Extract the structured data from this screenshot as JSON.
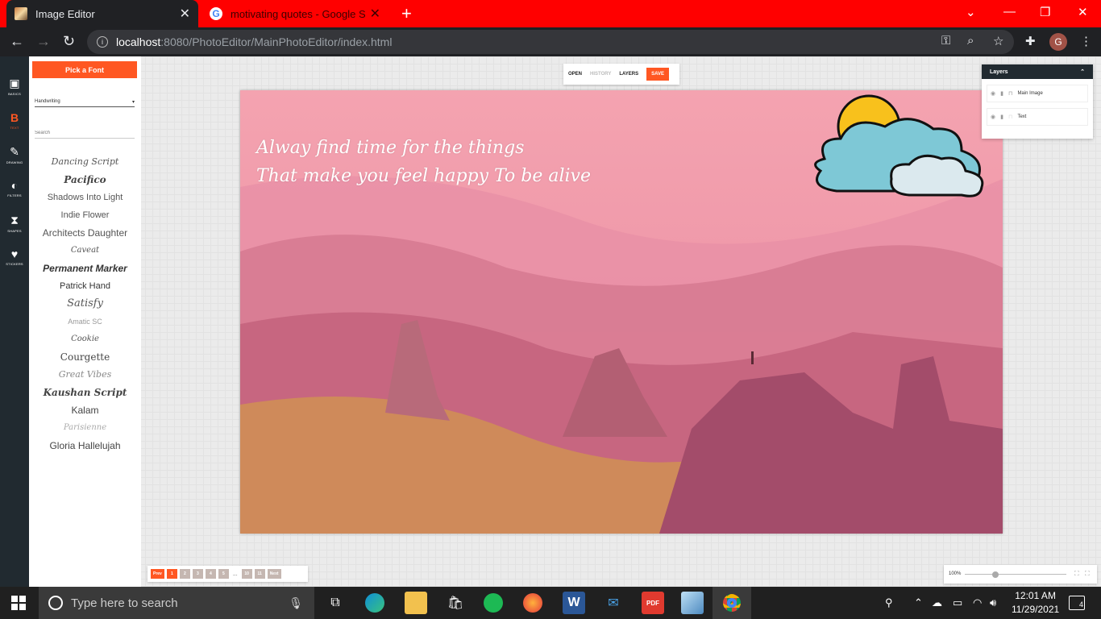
{
  "browser": {
    "tabs": [
      {
        "title": "Image Editor"
      },
      {
        "title": "motivating quotes - Google Sear",
        "favicon": "G"
      }
    ],
    "address": {
      "host": "localhost",
      "path": ":8080/PhotoEditor/MainPhotoEditor/index.html"
    },
    "avatar_letter": "G"
  },
  "rail": {
    "items": [
      {
        "label": "BASICS",
        "icon": "image-icon"
      },
      {
        "label": "TEXT",
        "icon": "text-icon",
        "glyph": "B"
      },
      {
        "label": "DRAWING",
        "icon": "brush-icon"
      },
      {
        "label": "FILTERS",
        "icon": "filters-icon"
      },
      {
        "label": "SHAPES",
        "icon": "shapes-icon"
      },
      {
        "label": "STICKERS",
        "icon": "heart-icon"
      }
    ]
  },
  "font_panel": {
    "pick_label": "Pick a Font",
    "category": "Handwriting",
    "search_placeholder": "Search",
    "fonts": [
      "Dancing Script",
      "Pacifico",
      "Shadows Into Light",
      "Indie Flower",
      "Architects Daughter",
      "Caveat",
      "Permanent Marker",
      "Patrick Hand",
      "Satisfy",
      "Amatic SC",
      "Cookie",
      "Courgette",
      "Great Vibes",
      "Kaushan Script",
      "Kalam",
      "Parisienne",
      "Gloria Hallelujah"
    ]
  },
  "top_menu": {
    "open": "OPEN",
    "history": "HISTORY",
    "layers": "LAYERS",
    "save": "SAVE"
  },
  "canvas": {
    "quote_line1": "Alway find time for the things",
    "quote_line2": "That make you feel happy To be alive"
  },
  "layers_panel": {
    "title": "Layers",
    "items": [
      {
        "name": "Main Image"
      },
      {
        "name": "Text"
      }
    ]
  },
  "pagination": {
    "prev": "Prev",
    "pages": [
      "1",
      "2",
      "3",
      "4",
      "5"
    ],
    "dots": "...",
    "tail_pages": [
      "10",
      "11"
    ],
    "next": "Next"
  },
  "zoom": {
    "label": "100%",
    "level": 0.3
  },
  "taskbar": {
    "search_placeholder": "Type here to search",
    "time": "12:01 AM",
    "date": "11/29/2021",
    "notifications": "4"
  },
  "colors": {
    "accent": "#ff5722",
    "chrome_red": "#ff0000",
    "rail": "#212a30"
  }
}
